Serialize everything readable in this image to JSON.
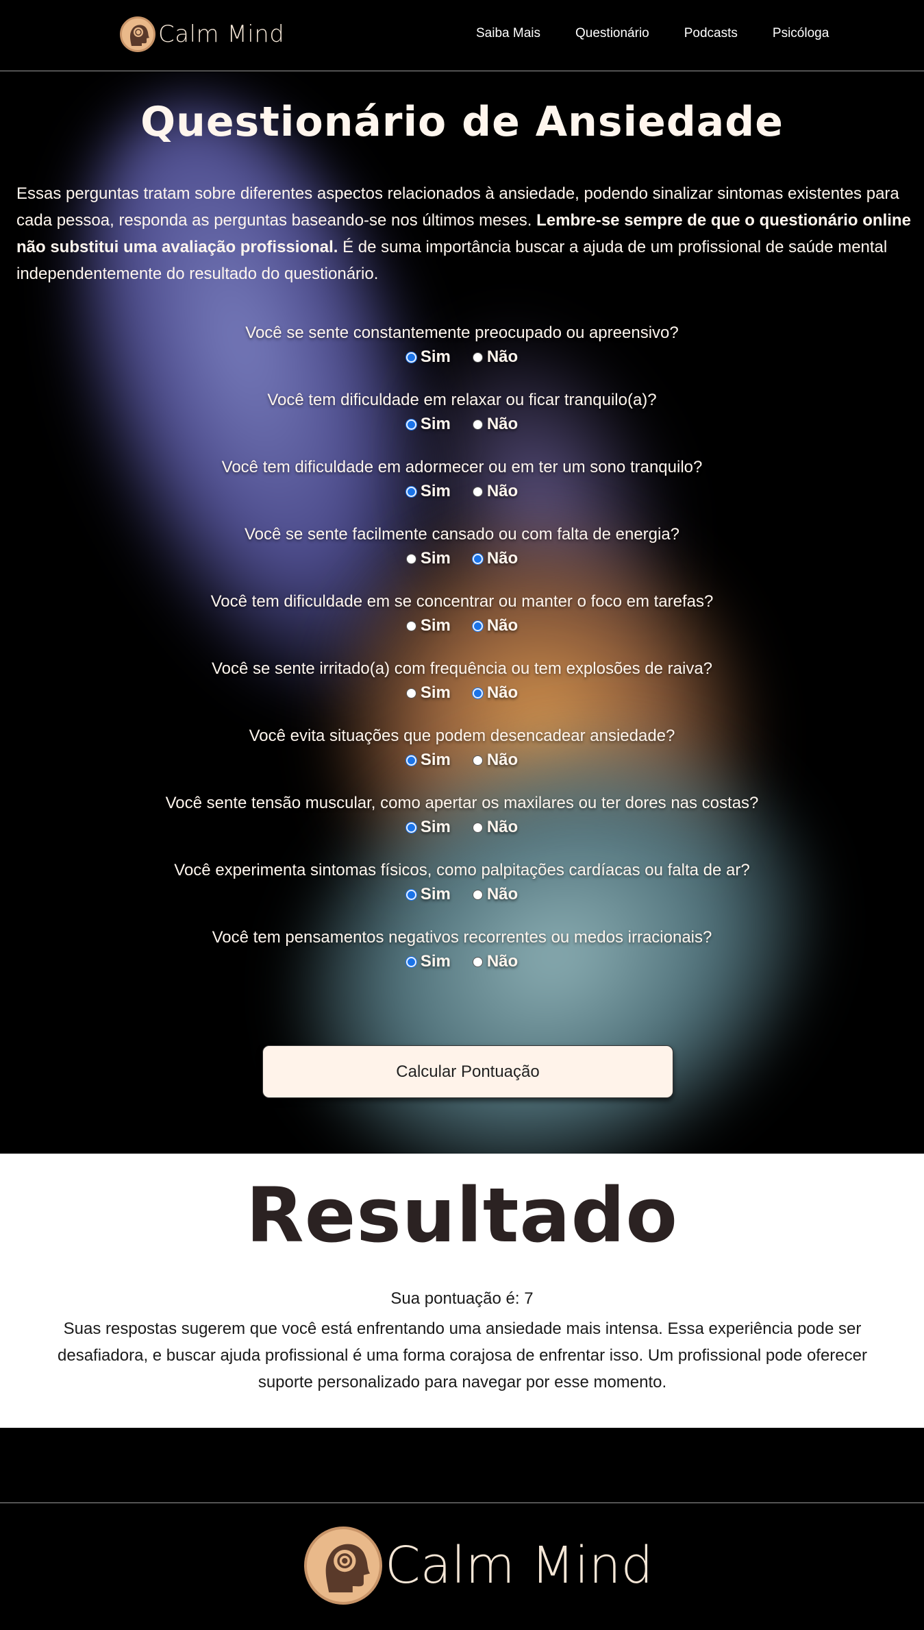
{
  "header": {
    "brand": "Calm Mind",
    "nav": [
      "Saiba Mais",
      "Questionário",
      "Podcasts",
      "Psicóloga"
    ]
  },
  "quiz": {
    "title": "Questionário de Ansiedade",
    "intro_part1": "Essas perguntas tratam sobre diferentes aspectos relacionados à ansiedade, podendo sinalizar sintomas existentes para cada pessoa, responda as perguntas baseando-se nos últimos meses. ",
    "intro_bold": "Lembre-se sempre de que o questionário online não substitui uma avaliação profissional.",
    "intro_part2": " É de suma importância buscar a ajuda de um profissional de saúde mental independentemente do resultado do questionário.",
    "yes_label": "Sim",
    "no_label": "Não",
    "questions": [
      {
        "text": "Você se sente constantemente preocupado ou apreensivo?",
        "answer": "Sim"
      },
      {
        "text": "Você tem dificuldade em relaxar ou ficar tranquilo(a)?",
        "answer": "Sim"
      },
      {
        "text": "Você tem dificuldade em adormecer ou em ter um sono tranquilo?",
        "answer": "Sim"
      },
      {
        "text": "Você se sente facilmente cansado ou com falta de energia?",
        "answer": "Não"
      },
      {
        "text": "Você tem dificuldade em se concentrar ou manter o foco em tarefas?",
        "answer": "Não"
      },
      {
        "text": "Você se sente irritado(a) com frequência ou tem explosões de raiva?",
        "answer": "Não"
      },
      {
        "text": "Você evita situações que podem desencadear ansiedade?",
        "answer": "Sim"
      },
      {
        "text": "Você sente tensão muscular, como apertar os maxilares ou ter dores nas costas?",
        "answer": "Sim"
      },
      {
        "text": "Você experimenta sintomas físicos, como palpitações cardíacas ou falta de ar?",
        "answer": "Sim"
      },
      {
        "text": "Você tem pensamentos negativos recorrentes ou medos irracionais?",
        "answer": "Sim"
      }
    ],
    "button": "Calcular Pontuação"
  },
  "result": {
    "title": "Resultado",
    "score": "Sua pontuação é: 7",
    "text": "Suas respostas sugerem que você está enfrentando uma ansiedade mais intensa. Essa experiência pode ser desafiadora, e buscar ajuda profissional é uma forma corajosa de enfrentar isso. Um profissional pode oferecer suporte personalizado para navegar por esse momento."
  },
  "footer": {
    "brand": "Calm Mind"
  },
  "colors": {
    "accent_cream": "#fff3ea",
    "radio_checked": "#1a73e8",
    "logo_tan": "#e9b98a"
  }
}
